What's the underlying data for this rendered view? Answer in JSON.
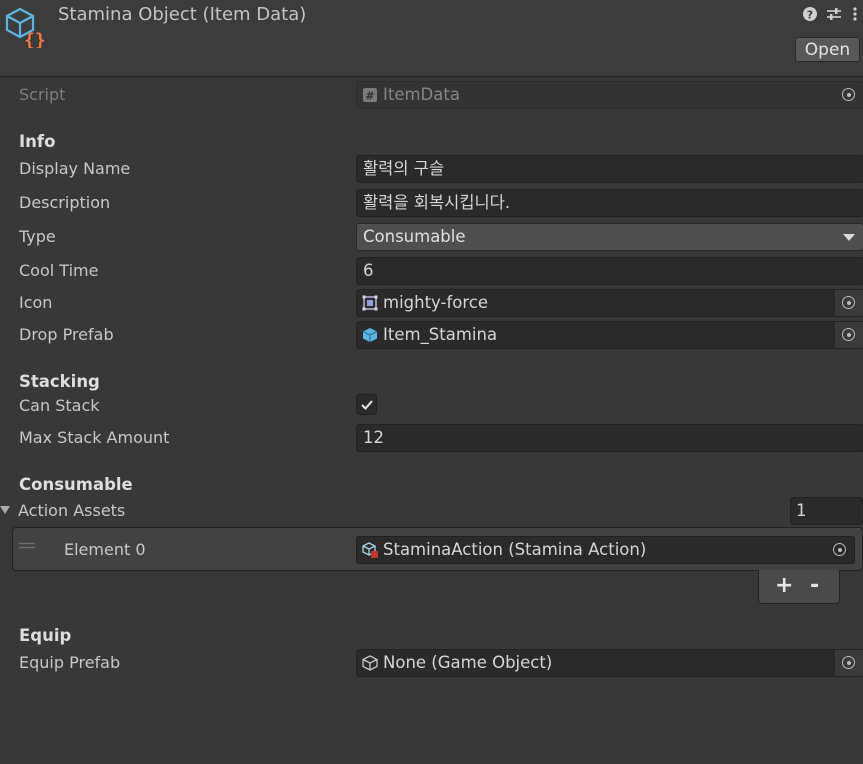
{
  "header": {
    "title": "Stamina Object (Item Data)",
    "open_label": "Open",
    "icons": [
      "scriptable-object-icon",
      "help-icon",
      "settings-sliders-icon",
      "kebab-menu-icon"
    ]
  },
  "script": {
    "label": "Script",
    "value": "ItemData"
  },
  "sections": {
    "info": "Info",
    "stacking": "Stacking",
    "consumable": "Consumable",
    "equip": "Equip"
  },
  "info": {
    "display_name_label": "Display Name",
    "display_name_value": "활력의 구슬",
    "description_label": "Description",
    "description_value": "활력을 회복시킵니다.",
    "type_label": "Type",
    "type_value": "Consumable",
    "cool_time_label": "Cool Time",
    "cool_time_value": "6",
    "icon_label": "Icon",
    "icon_value": "mighty-force",
    "drop_prefab_label": "Drop Prefab",
    "drop_prefab_value": "Item_Stamina"
  },
  "stacking": {
    "can_stack_label": "Can Stack",
    "can_stack_checked": true,
    "max_stack_label": "Max Stack Amount",
    "max_stack_value": "12"
  },
  "consumable": {
    "action_assets_label": "Action Assets",
    "count": "1",
    "elements": [
      {
        "label": "Element 0",
        "value": "StaminaAction (Stamina Action)"
      }
    ],
    "add_label": "+",
    "remove_label": "-"
  },
  "equip": {
    "equip_prefab_label": "Equip Prefab",
    "equip_prefab_value": "None (Game Object)"
  },
  "colors": {
    "background": "#383838",
    "field": "#2a2a2a",
    "asset_icon_blue": "#5ab6e8",
    "asset_icon_orange": "#ef7a3a"
  }
}
